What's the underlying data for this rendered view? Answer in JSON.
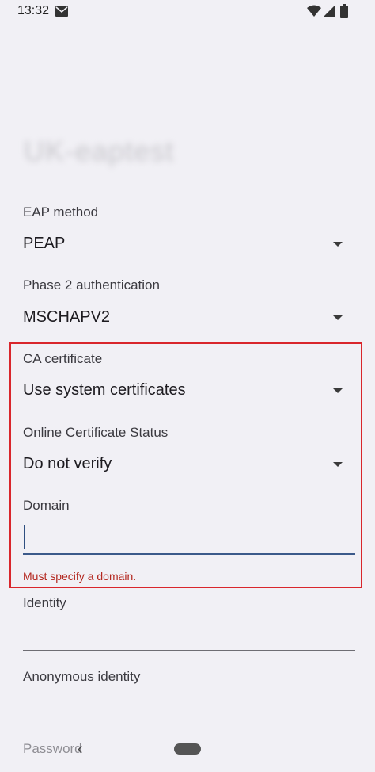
{
  "status_bar": {
    "time": "13:32",
    "icons": [
      "mail-icon",
      "wifi-icon",
      "signal-icon",
      "battery-icon"
    ]
  },
  "network_name": "UK-eaptest",
  "fields": {
    "eap_method": {
      "label": "EAP method",
      "value": "PEAP"
    },
    "phase2": {
      "label": "Phase 2 authentication",
      "value": "MSCHAPV2"
    },
    "ca_certificate": {
      "label": "CA certificate",
      "value": "Use system certificates"
    },
    "ocsp": {
      "label": "Online Certificate Status",
      "value": "Do not verify"
    },
    "domain": {
      "label": "Domain",
      "value": "",
      "error": "Must specify a domain."
    },
    "identity": {
      "label": "Identity",
      "value": ""
    },
    "anonymous_identity": {
      "label": "Anonymous identity",
      "value": ""
    },
    "password": {
      "label": "Password"
    }
  },
  "colors": {
    "background": "#f1f0f5",
    "highlight_border": "#d9262c",
    "error": "#b3261e",
    "focused_underline": "#3c5a8a"
  },
  "nav": {
    "back_glyph": "‹"
  }
}
